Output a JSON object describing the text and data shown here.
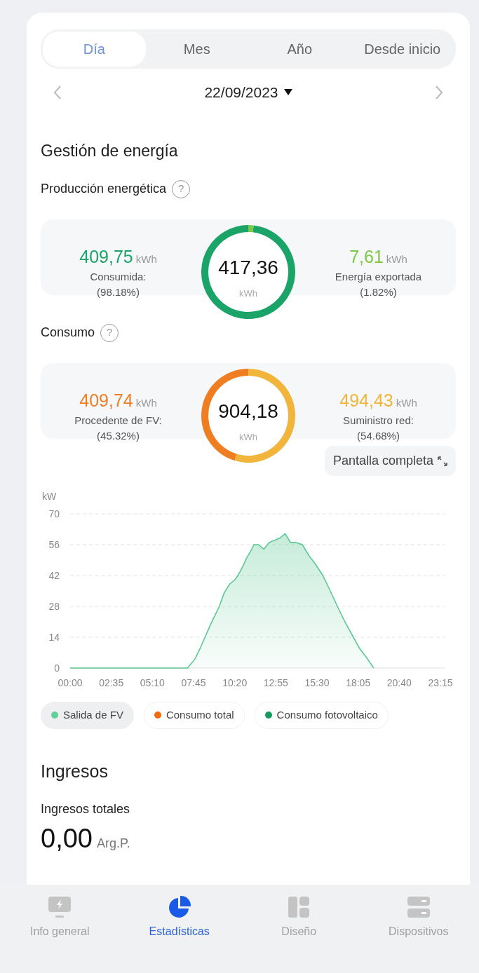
{
  "period_tabs": [
    {
      "label": "Día",
      "selected": true
    },
    {
      "label": "Mes",
      "selected": false
    },
    {
      "label": "Año",
      "selected": false
    },
    {
      "label": "Desde inicio",
      "selected": false
    }
  ],
  "date": "22/09/2023",
  "energy_section": {
    "title": "Gestión de energía",
    "blocks": [
      {
        "title": "Producción energética",
        "help": "?",
        "total": "417,36",
        "total_unit": "kWh",
        "chart_data": {
          "type": "donut",
          "values": [
            98.18,
            1.82
          ]
        },
        "left": {
          "value": "409,75",
          "unit": "kWh",
          "label": "Consumida:",
          "share": "(98.18%)",
          "color": "#1aa468"
        },
        "right": {
          "value": "7,61",
          "unit": "kWh",
          "label": "Energía exportada",
          "share": "(1.82%)",
          "color": "#7cc842"
        }
      },
      {
        "title": "Consumo",
        "help": "?",
        "total": "904,18",
        "total_unit": "kWh",
        "chart_data": {
          "type": "donut",
          "values": [
            45.32,
            54.68
          ]
        },
        "left": {
          "value": "409,74",
          "unit": "kWh",
          "label": "Procedente de FV:",
          "share": "(45.32%)",
          "color": "#ef7d22"
        },
        "right": {
          "value": "494,43",
          "unit": "kWh",
          "label": "Suministro red:",
          "share": "(54.68%)",
          "color": "#f0b53a"
        }
      }
    ],
    "fullscreen_button": "Pantalla completa",
    "chart_data": {
      "type": "area",
      "grid": true,
      "ylabel": "kW",
      "ylim": [
        0,
        70
      ],
      "yticks": [
        0,
        14,
        28,
        42,
        56,
        70
      ],
      "xlim": [
        0,
        1395
      ],
      "xticks": [
        {
          "value": 0,
          "label": "00:00"
        },
        {
          "value": 155,
          "label": "02:35"
        },
        {
          "value": 310,
          "label": "05:10"
        },
        {
          "value": 465,
          "label": "07:45"
        },
        {
          "value": 620,
          "label": "10:20"
        },
        {
          "value": 775,
          "label": "12:55"
        },
        {
          "value": 930,
          "label": "15:30"
        },
        {
          "value": 1085,
          "label": "18:05"
        },
        {
          "value": 1240,
          "label": "20:40"
        },
        {
          "value": 1395,
          "label": "23:15"
        }
      ],
      "x": [
        0,
        442,
        470,
        490,
        508,
        530,
        550,
        562,
        580,
        600,
        620,
        632,
        650,
        665,
        680,
        692,
        710,
        730,
        750,
        770,
        790,
        810,
        830,
        850,
        875,
        900,
        925,
        952,
        980,
        1007,
        1035,
        1067,
        1090,
        1115,
        1144
      ],
      "series": [
        {
          "color": "#5cc894",
          "values": [
            0,
            0,
            4,
            9,
            14,
            20,
            25,
            28,
            34,
            38,
            40,
            42,
            46,
            50,
            53,
            56,
            56,
            54,
            57,
            58,
            59,
            61,
            57,
            57,
            56,
            51,
            47,
            42,
            35,
            28,
            21,
            14,
            9,
            5,
            0
          ]
        }
      ]
    },
    "legend": [
      {
        "label": "Salida de FV",
        "color": "#5fd09a",
        "selected": true
      },
      {
        "label": "Consumo total",
        "color": "#f26a10",
        "selected": false
      },
      {
        "label": "Consumo fotovoltaico",
        "color": "#14995e",
        "selected": false
      }
    ]
  },
  "income_section": {
    "title": "Ingresos",
    "label": "Ingresos totales",
    "value": "0,00",
    "unit": "Arg.P."
  },
  "bottom_nav": [
    {
      "label": "Info general",
      "kind": "monitor",
      "selected": false
    },
    {
      "label": "Estadísticas",
      "kind": "pie",
      "selected": true
    },
    {
      "label": "Diseño",
      "kind": "layout",
      "selected": false
    },
    {
      "label": "Dispositivos",
      "kind": "devices",
      "selected": false
    }
  ]
}
